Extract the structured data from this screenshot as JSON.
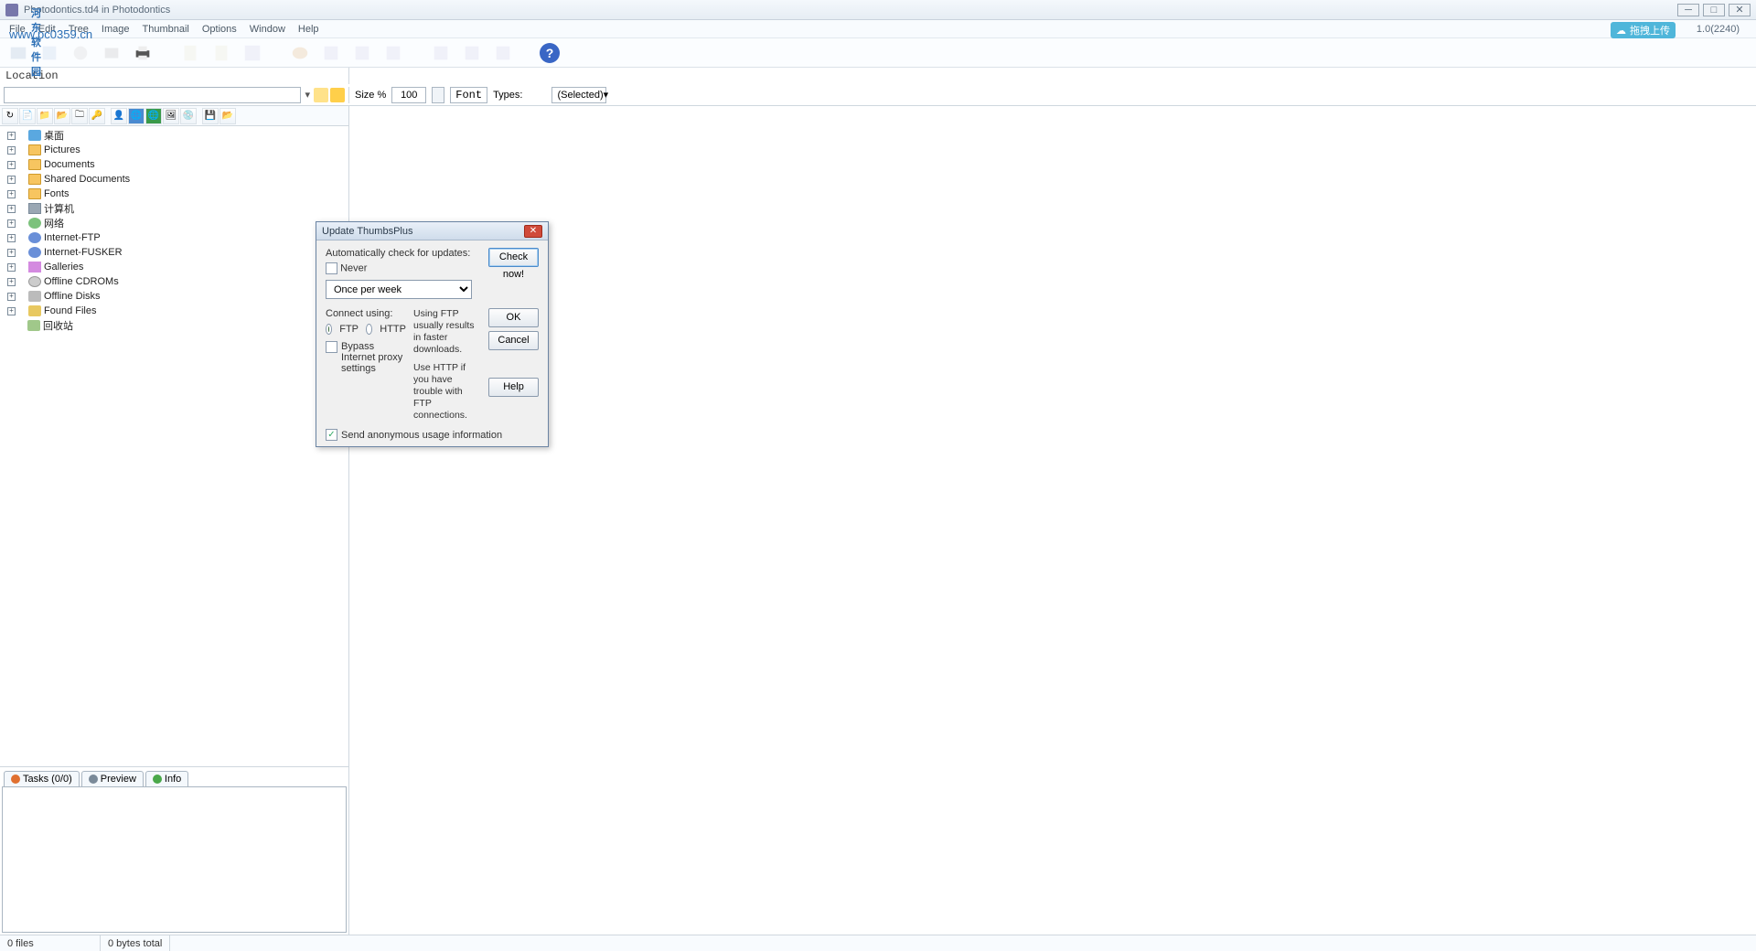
{
  "window": {
    "title": "Photodontics.td4 in Photodontics",
    "version": "1.0(2240)"
  },
  "watermark": {
    "line1": "河东软件园",
    "line2": "www.pc0359.cn"
  },
  "upload": {
    "label": "拖拽上传"
  },
  "menu": {
    "file": "File",
    "edit": "Edit",
    "tree": "Tree",
    "image": "Image",
    "thumbnail": "Thumbnail",
    "options": "Options",
    "window": "Window",
    "help": "Help"
  },
  "location": {
    "label": "Location"
  },
  "sizebar": {
    "size_label": "Size %",
    "size_value": "100",
    "font_label": "Font",
    "types_label": "Types:",
    "selected": "(Selected)"
  },
  "tree": {
    "items": [
      {
        "icon": "desktop",
        "label": "桌面"
      },
      {
        "icon": "folder",
        "label": "Pictures"
      },
      {
        "icon": "folder",
        "label": "Documents"
      },
      {
        "icon": "folder",
        "label": "Shared Documents"
      },
      {
        "icon": "folder",
        "label": "Fonts"
      },
      {
        "icon": "comp",
        "label": "计算机"
      },
      {
        "icon": "net",
        "label": "网络"
      },
      {
        "icon": "ftp",
        "label": "Internet-FTP"
      },
      {
        "icon": "ftp",
        "label": "Internet-FUSKER"
      },
      {
        "icon": "gal",
        "label": "Galleries"
      },
      {
        "icon": "cd",
        "label": "Offline CDROMs"
      },
      {
        "icon": "disk",
        "label": "Offline Disks"
      },
      {
        "icon": "find",
        "label": "Found Files"
      },
      {
        "icon": "recycle",
        "label": "回收站",
        "noexpand": true
      }
    ]
  },
  "tabs": {
    "tasks": "Tasks (0/0)",
    "preview": "Preview",
    "info": "Info"
  },
  "status": {
    "files": "0 files",
    "bytes": "0 bytes total"
  },
  "dialog": {
    "title": "Update ThumbsPlus",
    "auto_label": "Automatically check for updates:",
    "never": "Never",
    "frequency": "Once per week",
    "check_now": "Check now!",
    "connect_using": "Connect using:",
    "ftp": "FTP",
    "http": "HTTP",
    "bypass": "Bypass Internet proxy settings",
    "info1": "Using FTP usually results in faster downloads.",
    "info2": "Use HTTP if you have trouble with FTP connections.",
    "send_usage": "Send anonymous usage information",
    "ok": "OK",
    "cancel": "Cancel",
    "help": "Help"
  }
}
